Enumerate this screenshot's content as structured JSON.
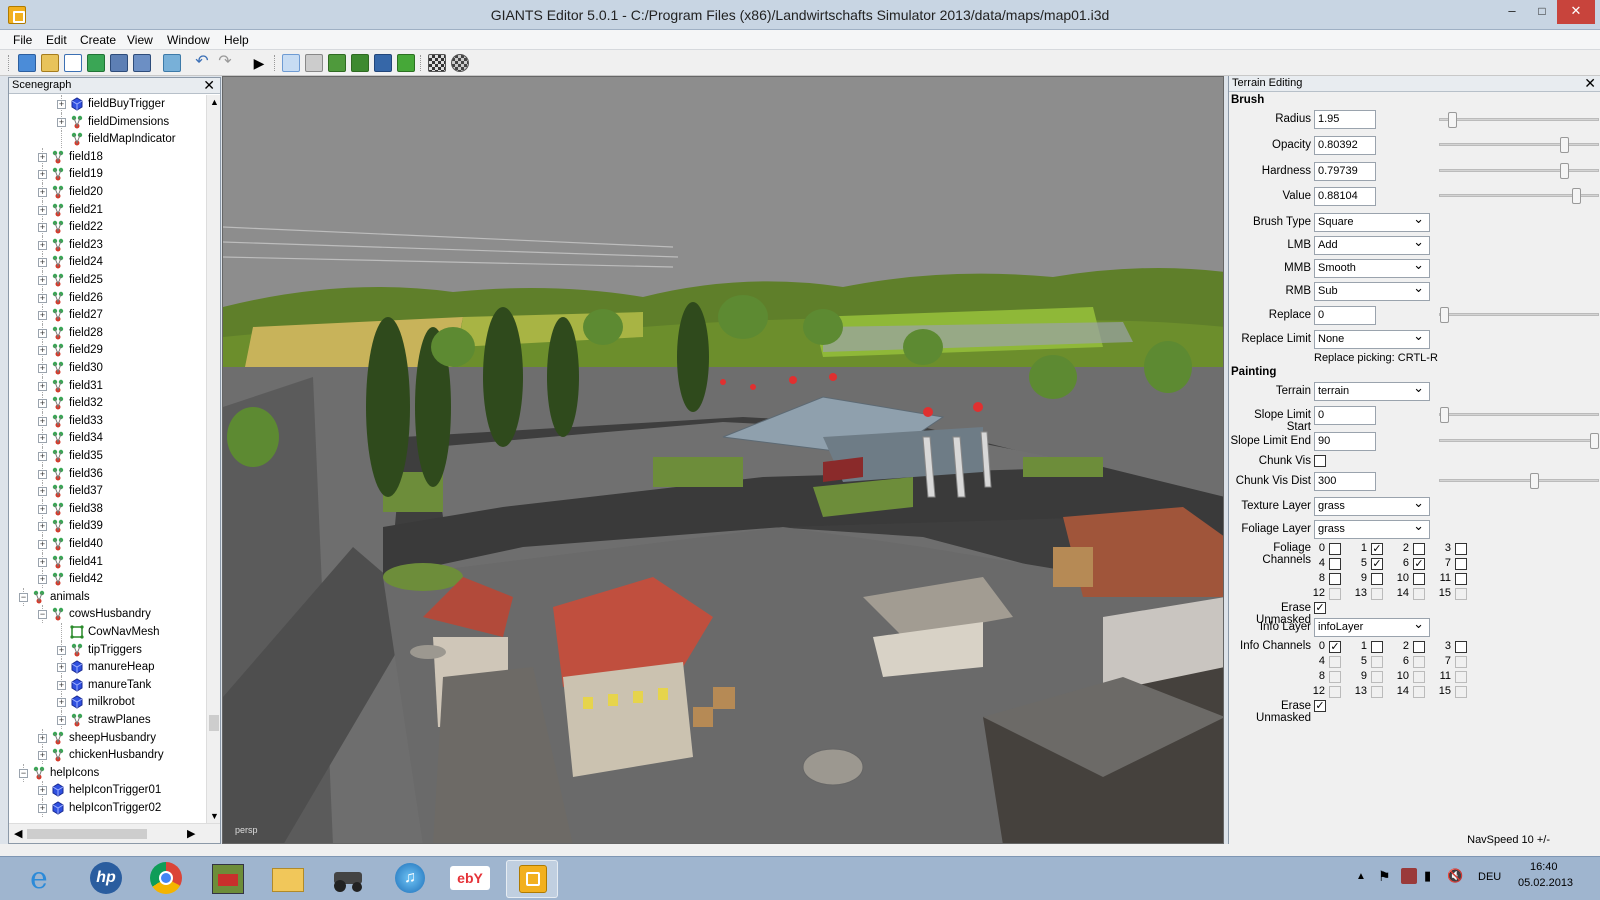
{
  "window": {
    "title": "GIANTS Editor 5.0.1 - C:/Program Files (x86)/Landwirtschafts Simulator 2013/data/maps/map01.i3d",
    "min": "–",
    "max": "□",
    "close": "✕"
  },
  "menu": [
    "File",
    "Edit",
    "Create",
    "View",
    "Window",
    "Help"
  ],
  "scenegraph": {
    "title": "Scenegraph",
    "close": "✕",
    "nodes": [
      {
        "label": "fieldBuyTrigger",
        "icon": "cube-icon",
        "depth": 2,
        "expand": "+"
      },
      {
        "label": "fieldDimensions",
        "icon": "transformgroup-icon",
        "depth": 2,
        "expand": "+"
      },
      {
        "label": "fieldMapIndicator",
        "icon": "transformgroup-icon",
        "depth": 2,
        "expand": ""
      },
      {
        "label": "field18",
        "icon": "transformgroup-icon",
        "depth": 1,
        "expand": "+"
      },
      {
        "label": "field19",
        "icon": "transformgroup-icon",
        "depth": 1,
        "expand": "+"
      },
      {
        "label": "field20",
        "icon": "transformgroup-icon",
        "depth": 1,
        "expand": "+"
      },
      {
        "label": "field21",
        "icon": "transformgroup-icon",
        "depth": 1,
        "expand": "+"
      },
      {
        "label": "field22",
        "icon": "transformgroup-icon",
        "depth": 1,
        "expand": "+"
      },
      {
        "label": "field23",
        "icon": "transformgroup-icon",
        "depth": 1,
        "expand": "+"
      },
      {
        "label": "field24",
        "icon": "transformgroup-icon",
        "depth": 1,
        "expand": "+"
      },
      {
        "label": "field25",
        "icon": "transformgroup-icon",
        "depth": 1,
        "expand": "+"
      },
      {
        "label": "field26",
        "icon": "transformgroup-icon",
        "depth": 1,
        "expand": "+"
      },
      {
        "label": "field27",
        "icon": "transformgroup-icon",
        "depth": 1,
        "expand": "+"
      },
      {
        "label": "field28",
        "icon": "transformgroup-icon",
        "depth": 1,
        "expand": "+"
      },
      {
        "label": "field29",
        "icon": "transformgroup-icon",
        "depth": 1,
        "expand": "+"
      },
      {
        "label": "field30",
        "icon": "transformgroup-icon",
        "depth": 1,
        "expand": "+"
      },
      {
        "label": "field31",
        "icon": "transformgroup-icon",
        "depth": 1,
        "expand": "+"
      },
      {
        "label": "field32",
        "icon": "transformgroup-icon",
        "depth": 1,
        "expand": "+"
      },
      {
        "label": "field33",
        "icon": "transformgroup-icon",
        "depth": 1,
        "expand": "+"
      },
      {
        "label": "field34",
        "icon": "transformgroup-icon",
        "depth": 1,
        "expand": "+"
      },
      {
        "label": "field35",
        "icon": "transformgroup-icon",
        "depth": 1,
        "expand": "+"
      },
      {
        "label": "field36",
        "icon": "transformgroup-icon",
        "depth": 1,
        "expand": "+"
      },
      {
        "label": "field37",
        "icon": "transformgroup-icon",
        "depth": 1,
        "expand": "+"
      },
      {
        "label": "field38",
        "icon": "transformgroup-icon",
        "depth": 1,
        "expand": "+"
      },
      {
        "label": "field39",
        "icon": "transformgroup-icon",
        "depth": 1,
        "expand": "+"
      },
      {
        "label": "field40",
        "icon": "transformgroup-icon",
        "depth": 1,
        "expand": "+"
      },
      {
        "label": "field41",
        "icon": "transformgroup-icon",
        "depth": 1,
        "expand": "+"
      },
      {
        "label": "field42",
        "icon": "transformgroup-icon",
        "depth": 1,
        "expand": "+"
      },
      {
        "label": "animals",
        "icon": "transformgroup-icon",
        "depth": 0,
        "expand": "−"
      },
      {
        "label": "cowsHusbandry",
        "icon": "transformgroup-icon",
        "depth": 1,
        "expand": "−"
      },
      {
        "label": "CowNavMesh",
        "icon": "navmesh-icon",
        "depth": 2,
        "expand": ""
      },
      {
        "label": "tipTriggers",
        "icon": "transformgroup-icon",
        "depth": 2,
        "expand": "+"
      },
      {
        "label": "manureHeap",
        "icon": "cube-icon",
        "depth": 2,
        "expand": "+"
      },
      {
        "label": "manureTank",
        "icon": "cube-icon",
        "depth": 2,
        "expand": "+"
      },
      {
        "label": "milkrobot",
        "icon": "cube-icon",
        "depth": 2,
        "expand": "+"
      },
      {
        "label": "strawPlanes",
        "icon": "transformgroup-icon",
        "depth": 2,
        "expand": "+"
      },
      {
        "label": "sheepHusbandry",
        "icon": "transformgroup-icon",
        "depth": 1,
        "expand": "+"
      },
      {
        "label": "chickenHusbandry",
        "icon": "transformgroup-icon",
        "depth": 1,
        "expand": "+"
      },
      {
        "label": "helpIcons",
        "icon": "transformgroup-icon",
        "depth": 0,
        "expand": "−"
      },
      {
        "label": "helpIconTrigger01",
        "icon": "cube-icon",
        "depth": 1,
        "expand": "+"
      },
      {
        "label": "helpIconTrigger02",
        "icon": "cube-icon",
        "depth": 1,
        "expand": "+"
      }
    ]
  },
  "viewport": {
    "camera_label": "persp"
  },
  "terrain": {
    "title": "Terrain Editing",
    "close": "✕",
    "brush_section": "Brush",
    "radius": {
      "label": "Radius",
      "value": "1.95",
      "slider": 0.05
    },
    "opacity": {
      "label": "Opacity",
      "value": "0.80392",
      "slider": 0.8
    },
    "hardness": {
      "label": "Hardness",
      "value": "0.79739",
      "slider": 0.8
    },
    "value": {
      "label": "Value",
      "value": "0.88104",
      "slider": 0.88
    },
    "brush_type": {
      "label": "Brush Type",
      "value": "Square"
    },
    "lmb": {
      "label": "LMB",
      "value": "Add"
    },
    "mmb": {
      "label": "MMB",
      "value": "Smooth"
    },
    "rmb": {
      "label": "RMB",
      "value": "Sub"
    },
    "replace": {
      "label": "Replace",
      "value": "0",
      "slider": 0.0
    },
    "replace_limit": {
      "label": "Replace Limit",
      "value": "None"
    },
    "replace_hint": "Replace picking: CRTL-R",
    "painting_section": "Painting",
    "terrain_sel": {
      "label": "Terrain",
      "value": "terrain"
    },
    "slope_start": {
      "label": "Slope Limit Start",
      "value": "0",
      "slider": 0.0
    },
    "slope_end": {
      "label": "Slope Limit End",
      "value": "90",
      "slider": 1.0
    },
    "chunk_vis": {
      "label": "Chunk Vis"
    },
    "chunk_vis_dist": {
      "label": "Chunk Vis Dist",
      "value": "300",
      "slider": 0.6
    },
    "texture_layer": {
      "label": "Texture Layer",
      "value": "grass"
    },
    "foliage_layer": {
      "label": "Foliage Layer",
      "value": "grass"
    },
    "foliage_channels": {
      "label": "Foliage Channels",
      "nums": [
        "0",
        "1",
        "2",
        "3",
        "4",
        "5",
        "6",
        "7",
        "8",
        "9",
        "10",
        "11",
        "12",
        "13",
        "14",
        "15"
      ],
      "checked": [
        1,
        5,
        6
      ]
    },
    "erase_unmasked_1": {
      "label": "Erase Unmasked"
    },
    "info_layer": {
      "label": "Info Layer",
      "value": "infoLayer"
    },
    "info_channels": {
      "label": "Info Channels",
      "nums": [
        "0",
        "1",
        "2",
        "3",
        "4",
        "5",
        "6",
        "7",
        "8",
        "9",
        "10",
        "11",
        "12",
        "13",
        "14",
        "15"
      ],
      "checked": [
        0
      ]
    },
    "erase_unmasked_2": {
      "label": "Erase Unmasked"
    },
    "check_mark": "✓"
  },
  "status": {
    "navspeed": "NavSpeed 10 +/-"
  },
  "taskbar": {
    "lang": "DEU",
    "time": "16:40",
    "date": "05.02.2013",
    "apps": [
      "internet-explorer-icon",
      "hp-icon",
      "chrome-icon",
      "farming-sim-icon",
      "file-explorer-icon",
      "tractor-icon",
      "itunes-icon",
      "ebay-icon",
      "giants-editor-icon"
    ],
    "ebay": "ebY"
  },
  "colors": {
    "accent": "#316ac5",
    "taskbar": "#9fb5cf"
  }
}
